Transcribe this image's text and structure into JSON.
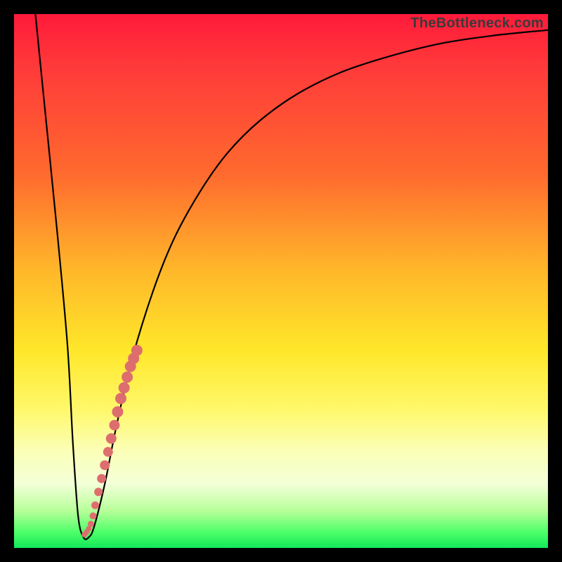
{
  "watermark": "TheBottleneck.com",
  "chart_data": {
    "type": "line",
    "title": "",
    "xlabel": "",
    "ylabel": "",
    "xlim": [
      0,
      100
    ],
    "ylim": [
      0,
      100
    ],
    "grid": false,
    "legend": "none",
    "series": [
      {
        "name": "bottleneck-curve",
        "x": [
          4,
          6,
          8,
          10,
          11,
          12,
          13,
          14,
          15,
          17,
          19,
          22,
          26,
          30,
          35,
          40,
          46,
          53,
          61,
          70,
          80,
          90,
          100
        ],
        "values": [
          100,
          80,
          60,
          38,
          20,
          6,
          2,
          2,
          4,
          12,
          22,
          35,
          48,
          58,
          67,
          74,
          80,
          85,
          89,
          92,
          94.5,
          96,
          97
        ]
      }
    ],
    "marker_cluster": {
      "name": "highlight-segment",
      "color": "#de6e6e",
      "x": [
        13.2,
        13.6,
        14.0,
        14.4,
        14.8,
        15.2,
        15.8,
        16.4,
        17.0,
        17.6,
        18.2,
        18.8,
        19.4,
        20.0,
        20.6,
        21.2,
        21.8,
        22.4,
        23.0
      ],
      "values": [
        2.5,
        3.0,
        3.6,
        4.5,
        6.0,
        8.0,
        10.5,
        13.0,
        15.5,
        18.0,
        20.5,
        23.0,
        25.5,
        28.0,
        30.0,
        32.0,
        34.0,
        35.5,
        37.0
      ],
      "radius": [
        4,
        4,
        4,
        4.5,
        5,
        5.5,
        6,
        6.5,
        7,
        7,
        7.5,
        7.5,
        8,
        8,
        8,
        8,
        8,
        8,
        8
      ]
    },
    "background_gradient": {
      "top": "#ff1a3a",
      "upper_mid": "#ffb72a",
      "mid": "#ffe72a",
      "lower_mid": "#f3ffd8",
      "bottom": "#12e85a"
    }
  }
}
